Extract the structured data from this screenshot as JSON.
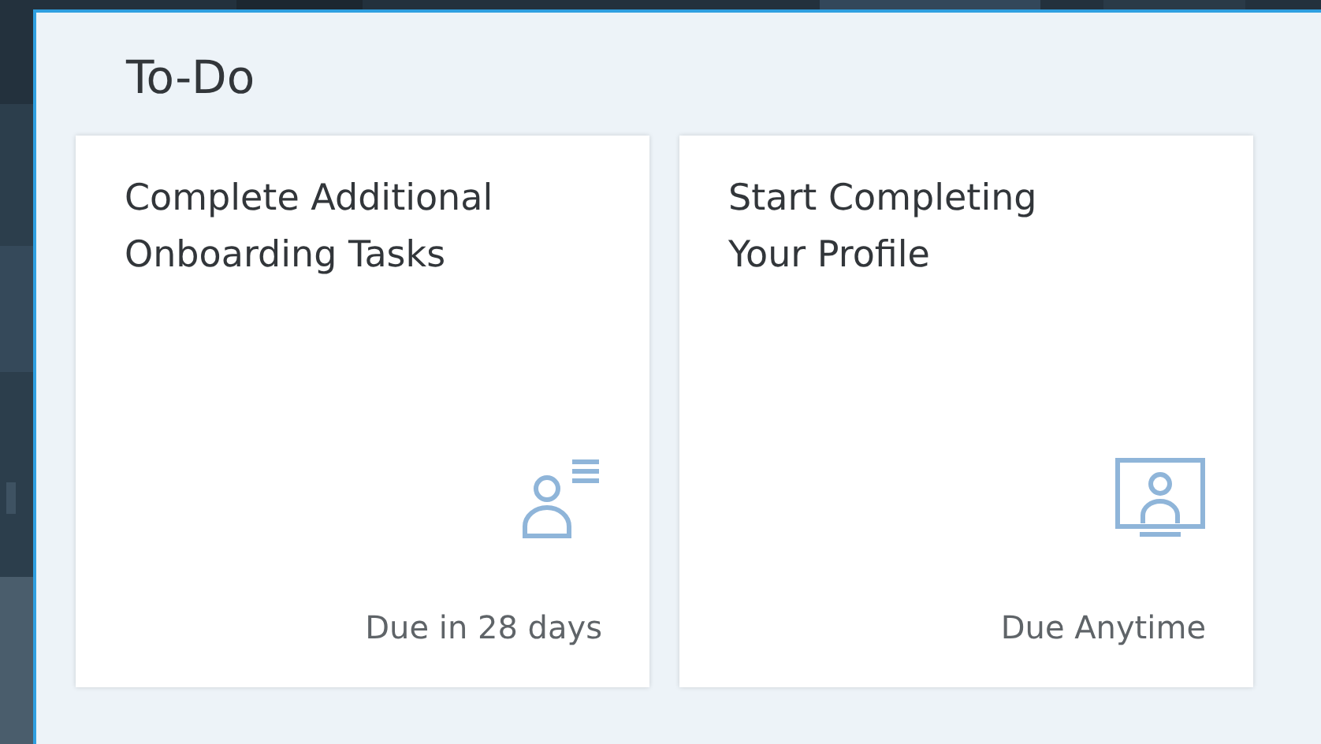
{
  "section": {
    "title": "To-Do"
  },
  "cards": [
    {
      "kind": "tasks",
      "title": "Complete Additional Onboarding Tasks",
      "due": "Due in 28 days"
    },
    {
      "kind": "profile",
      "title": "Start Completing Your Profile",
      "due": "Due Anytime"
    }
  ]
}
